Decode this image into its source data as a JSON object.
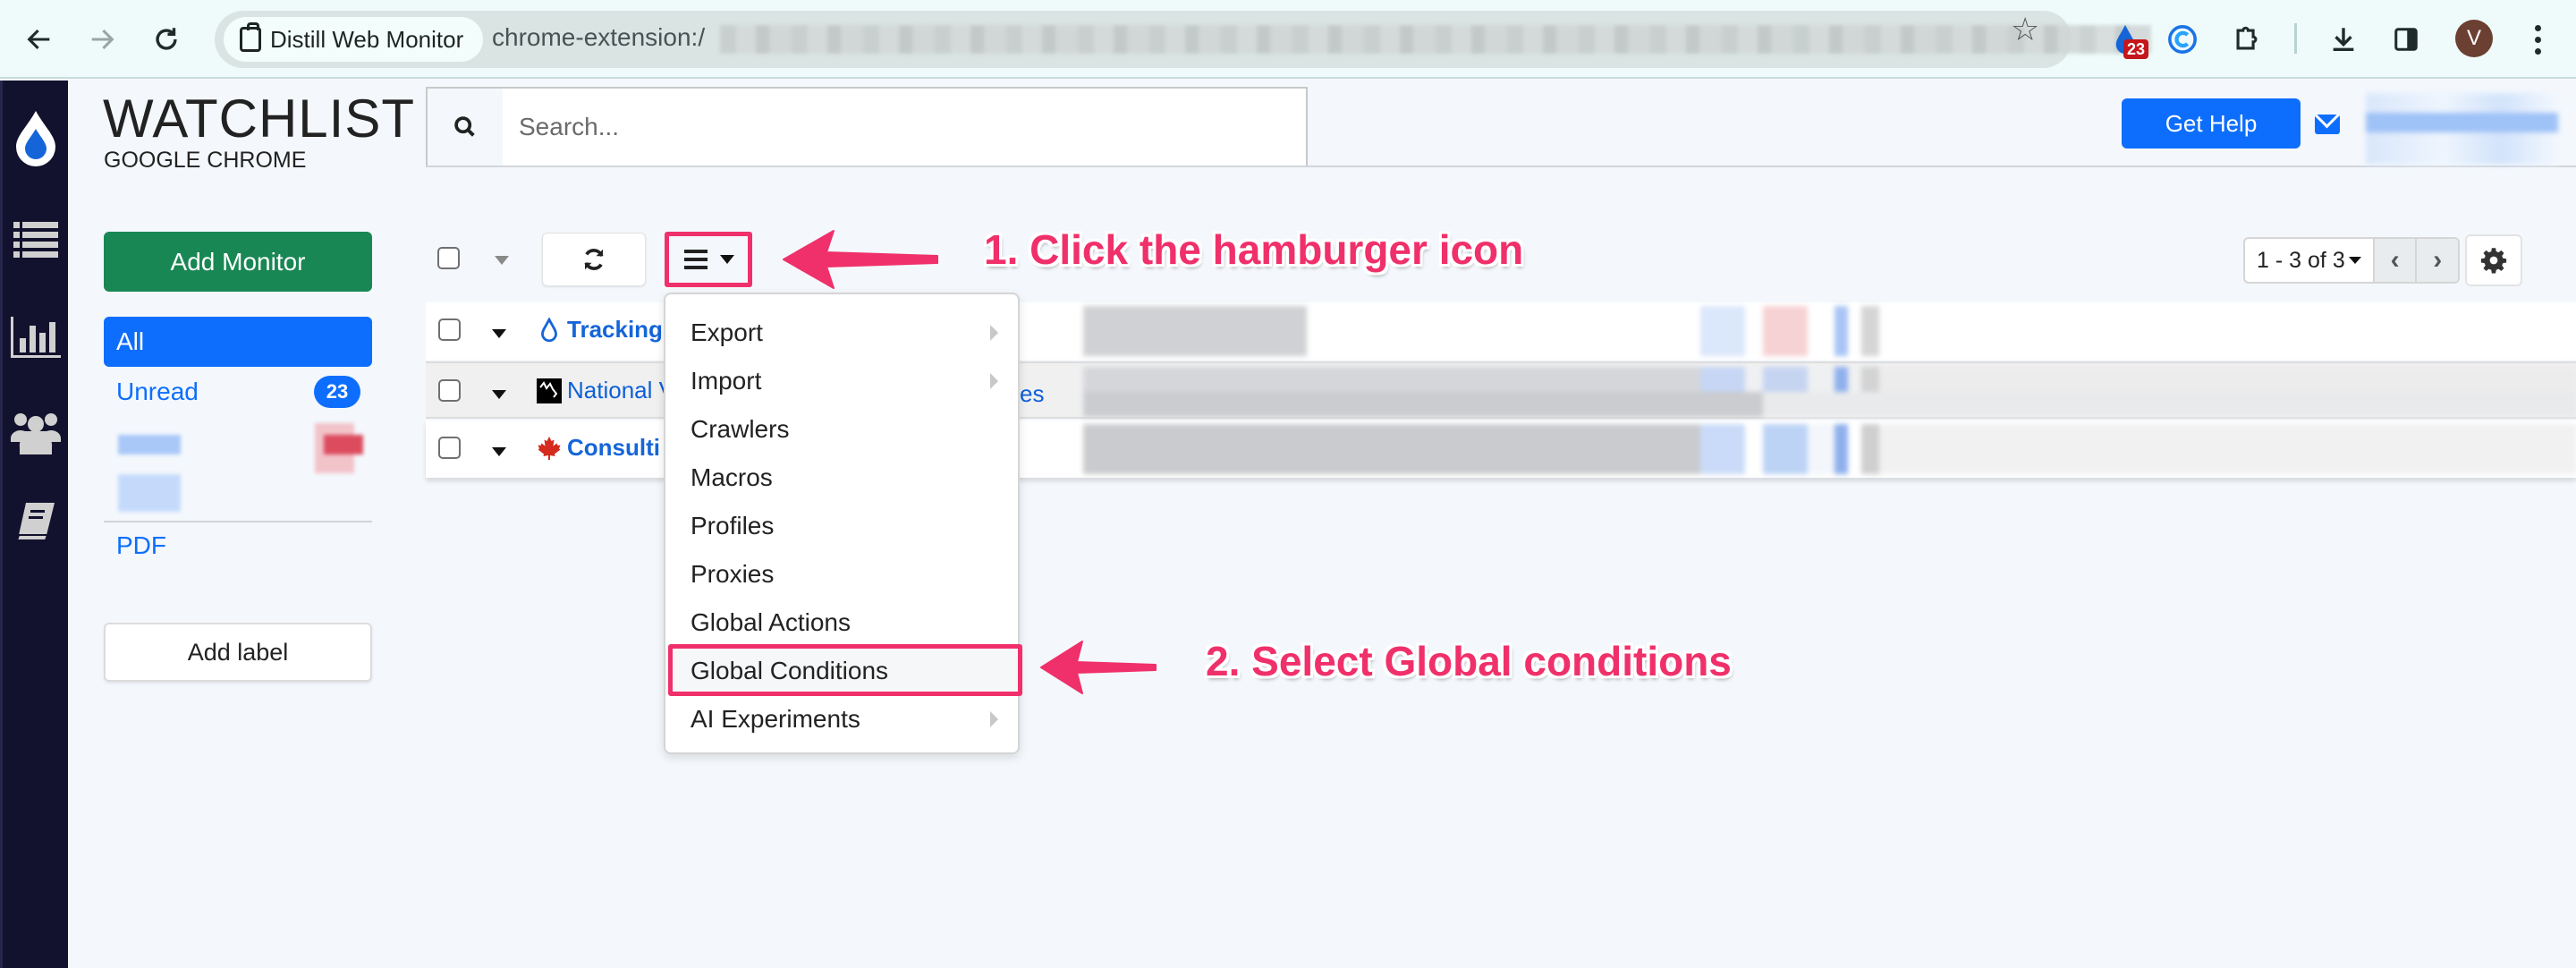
{
  "browser": {
    "tab_chip_title": "Distill Web Monitor",
    "url_prefix": "chrome-extension:/",
    "extension_badge": "23",
    "profile_initial": "V"
  },
  "app": {
    "title": "WATCHLIST",
    "subtitle": "GOOGLE CHROME",
    "search_placeholder": "Search...",
    "get_help_label": "Get Help",
    "brand_color": "#0d6efd",
    "nav_rail": [
      "logo-drop",
      "watchlist",
      "reports",
      "team",
      "docs"
    ]
  },
  "labels_panel": {
    "add_monitor_label": "Add Monitor",
    "all_label": "All",
    "unread_label": "Unread",
    "unread_count": "23",
    "pdf_label": "PDF",
    "add_label_label": "Add label"
  },
  "toolbar": {
    "pager_label": "1 - 3 of 3",
    "prev_label": "‹",
    "next_label": "›"
  },
  "monitors": [
    {
      "name": "Tracking",
      "icon": "drop-icon",
      "bold": true,
      "tail": ""
    },
    {
      "name": "National V",
      "icon": "nws-logo-icon",
      "bold": false,
      "tail": "es"
    },
    {
      "name": "Consulti",
      "icon": "maple-leaf-icon",
      "bold": true,
      "tail": ""
    }
  ],
  "menu": {
    "items": [
      {
        "label": "Export",
        "submenu": true
      },
      {
        "label": "Import",
        "submenu": true
      },
      {
        "label": "Crawlers",
        "submenu": false
      },
      {
        "label": "Macros",
        "submenu": false
      },
      {
        "label": "Profiles",
        "submenu": false
      },
      {
        "label": "Proxies",
        "submenu": false
      },
      {
        "label": "Global Actions",
        "submenu": false
      },
      {
        "label": "Global Conditions",
        "submenu": false,
        "highlighted": true
      },
      {
        "label": "AI Experiments",
        "submenu": true
      }
    ]
  },
  "annotations": {
    "step1": "1. Click the hamburger icon",
    "step2": "2. Select Global conditions",
    "color": "#f0306a"
  }
}
